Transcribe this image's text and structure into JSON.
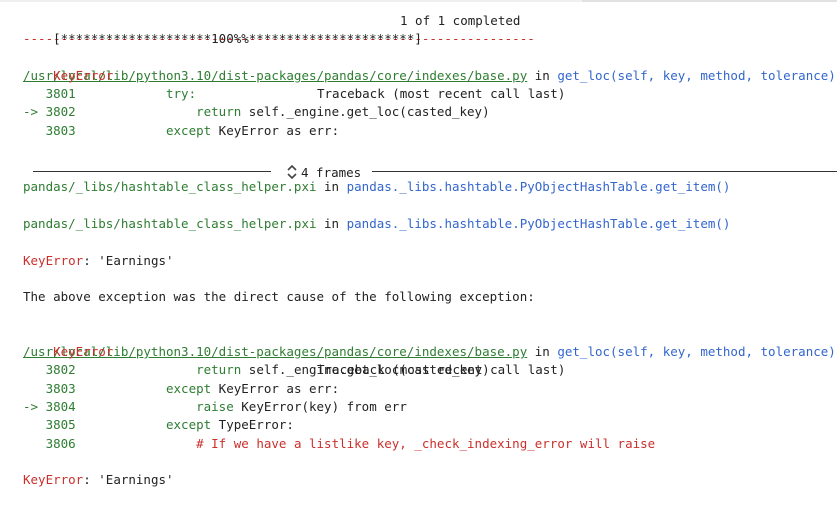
{
  "progress": {
    "bar": "[********************100%%**********************]",
    "count": "1 of 1 completed"
  },
  "separator": "---------------------------------------------------------------------------",
  "tb1": {
    "error_name": "KeyError",
    "traceback_label": "Traceback (most recent call last)",
    "path": "/usr/local/lib/python3.10/dist-packages/pandas/core/indexes/base.py",
    "in_word": "in",
    "func": "get_loc(self, key, method, tolerance)",
    "lines": [
      {
        "arrow": "   ",
        "num": "3801",
        "indent": "            ",
        "kw": "try:",
        "rest": ""
      },
      {
        "arrow": "-> ",
        "num": "3802",
        "indent": "                ",
        "kw": "return",
        "rest": " self._engine.get_loc(casted_key)"
      },
      {
        "arrow": "   ",
        "num": "3803",
        "indent": "            ",
        "kw": "except",
        "rest": " KeyError as err:"
      }
    ]
  },
  "collapsed": {
    "label": "4 frames"
  },
  "hashtable": [
    {
      "path": "pandas/_libs/hashtable_class_helper.pxi",
      "in_word": "in",
      "func": "pandas._libs.hashtable.PyObjectHashTable.get_item()"
    },
    {
      "path": "pandas/_libs/hashtable_class_helper.pxi",
      "in_word": "in",
      "func": "pandas._libs.hashtable.PyObjectHashTable.get_item()"
    }
  ],
  "error1": {
    "name": "KeyError",
    "message": ": 'Earnings'"
  },
  "cause_text": "The above exception was the direct cause of the following exception:",
  "tb2": {
    "error_name": "KeyError",
    "traceback_label": "Traceback (most recent call last)",
    "path": "/usr/local/lib/python3.10/dist-packages/pandas/core/indexes/base.py",
    "in_word": "in",
    "func": "get_loc(self, key, method, tolerance)",
    "lines": [
      {
        "arrow": "   ",
        "num": "3802",
        "indent": "                ",
        "kw": "return",
        "rest": " self._engine.get_loc(casted_key)",
        "comment": false
      },
      {
        "arrow": "   ",
        "num": "3803",
        "indent": "            ",
        "kw": "except",
        "rest": " KeyError as err:",
        "comment": false
      },
      {
        "arrow": "-> ",
        "num": "3804",
        "indent": "                ",
        "kw": "raise",
        "rest": " KeyError(key) from err",
        "comment": false
      },
      {
        "arrow": "   ",
        "num": "3805",
        "indent": "            ",
        "kw": "except",
        "rest": " TypeError:",
        "comment": false
      },
      {
        "arrow": "   ",
        "num": "3806",
        "indent": "                ",
        "kw": "",
        "rest": "# If we have a listlike key, _check_indexing_error will raise",
        "comment": true
      }
    ]
  },
  "error2": {
    "name": "KeyError",
    "message": ": 'Earnings'"
  },
  "colors": {
    "error": "#c9302c",
    "path": "#2e7d32",
    "func": "#3366cc"
  }
}
